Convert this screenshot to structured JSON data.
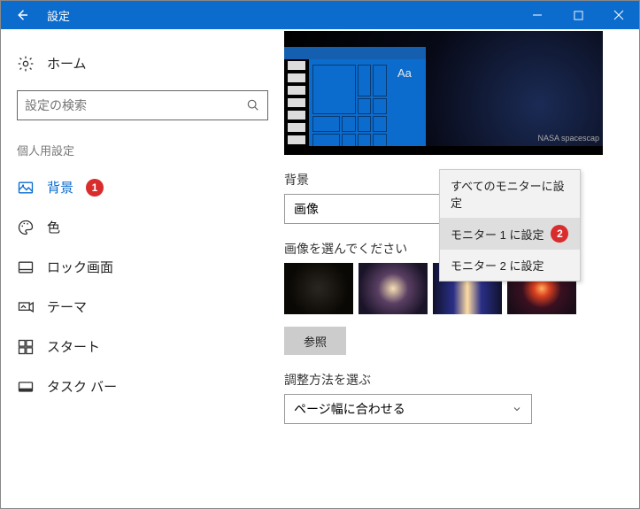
{
  "titlebar": {
    "title": "設定"
  },
  "sidebar": {
    "home": "ホーム",
    "search_placeholder": "設定の検索",
    "section": "個人用設定",
    "items": [
      {
        "label": "背景",
        "badge": "1"
      },
      {
        "label": "色"
      },
      {
        "label": "ロック画面"
      },
      {
        "label": "テーマ"
      },
      {
        "label": "スタート"
      },
      {
        "label": "タスク バー"
      }
    ]
  },
  "main": {
    "preview_sample": "Aa",
    "preview_credit": "NASA spacescap",
    "bg_label": "背景",
    "bg_value": "画像",
    "choose_label": "画像を選んでください",
    "browse": "参照",
    "fit_label": "調整方法を選ぶ",
    "fit_value": "ページ幅に合わせる"
  },
  "context_menu": {
    "items": [
      "すべてのモニターに設定",
      "モニター 1 に設定",
      "モニター 2 に設定"
    ],
    "badge": "2"
  }
}
